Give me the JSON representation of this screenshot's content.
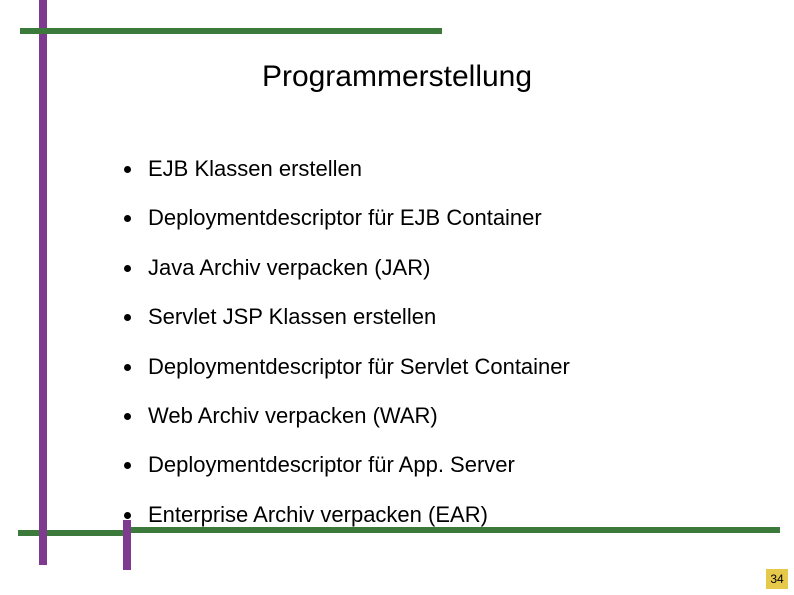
{
  "title": "Programmerstellung",
  "bullets": [
    "EJB Klassen erstellen",
    "Deploymentdescriptor für EJB Container",
    "Java Archiv verpacken (JAR)",
    "Servlet JSP Klassen erstellen",
    "Deploymentdescriptor für Servlet Container",
    "Web Archiv verpacken (WAR)",
    "Deploymentdescriptor für App. Server",
    "Enterprise Archiv verpacken (EAR)"
  ],
  "page_number": "34"
}
